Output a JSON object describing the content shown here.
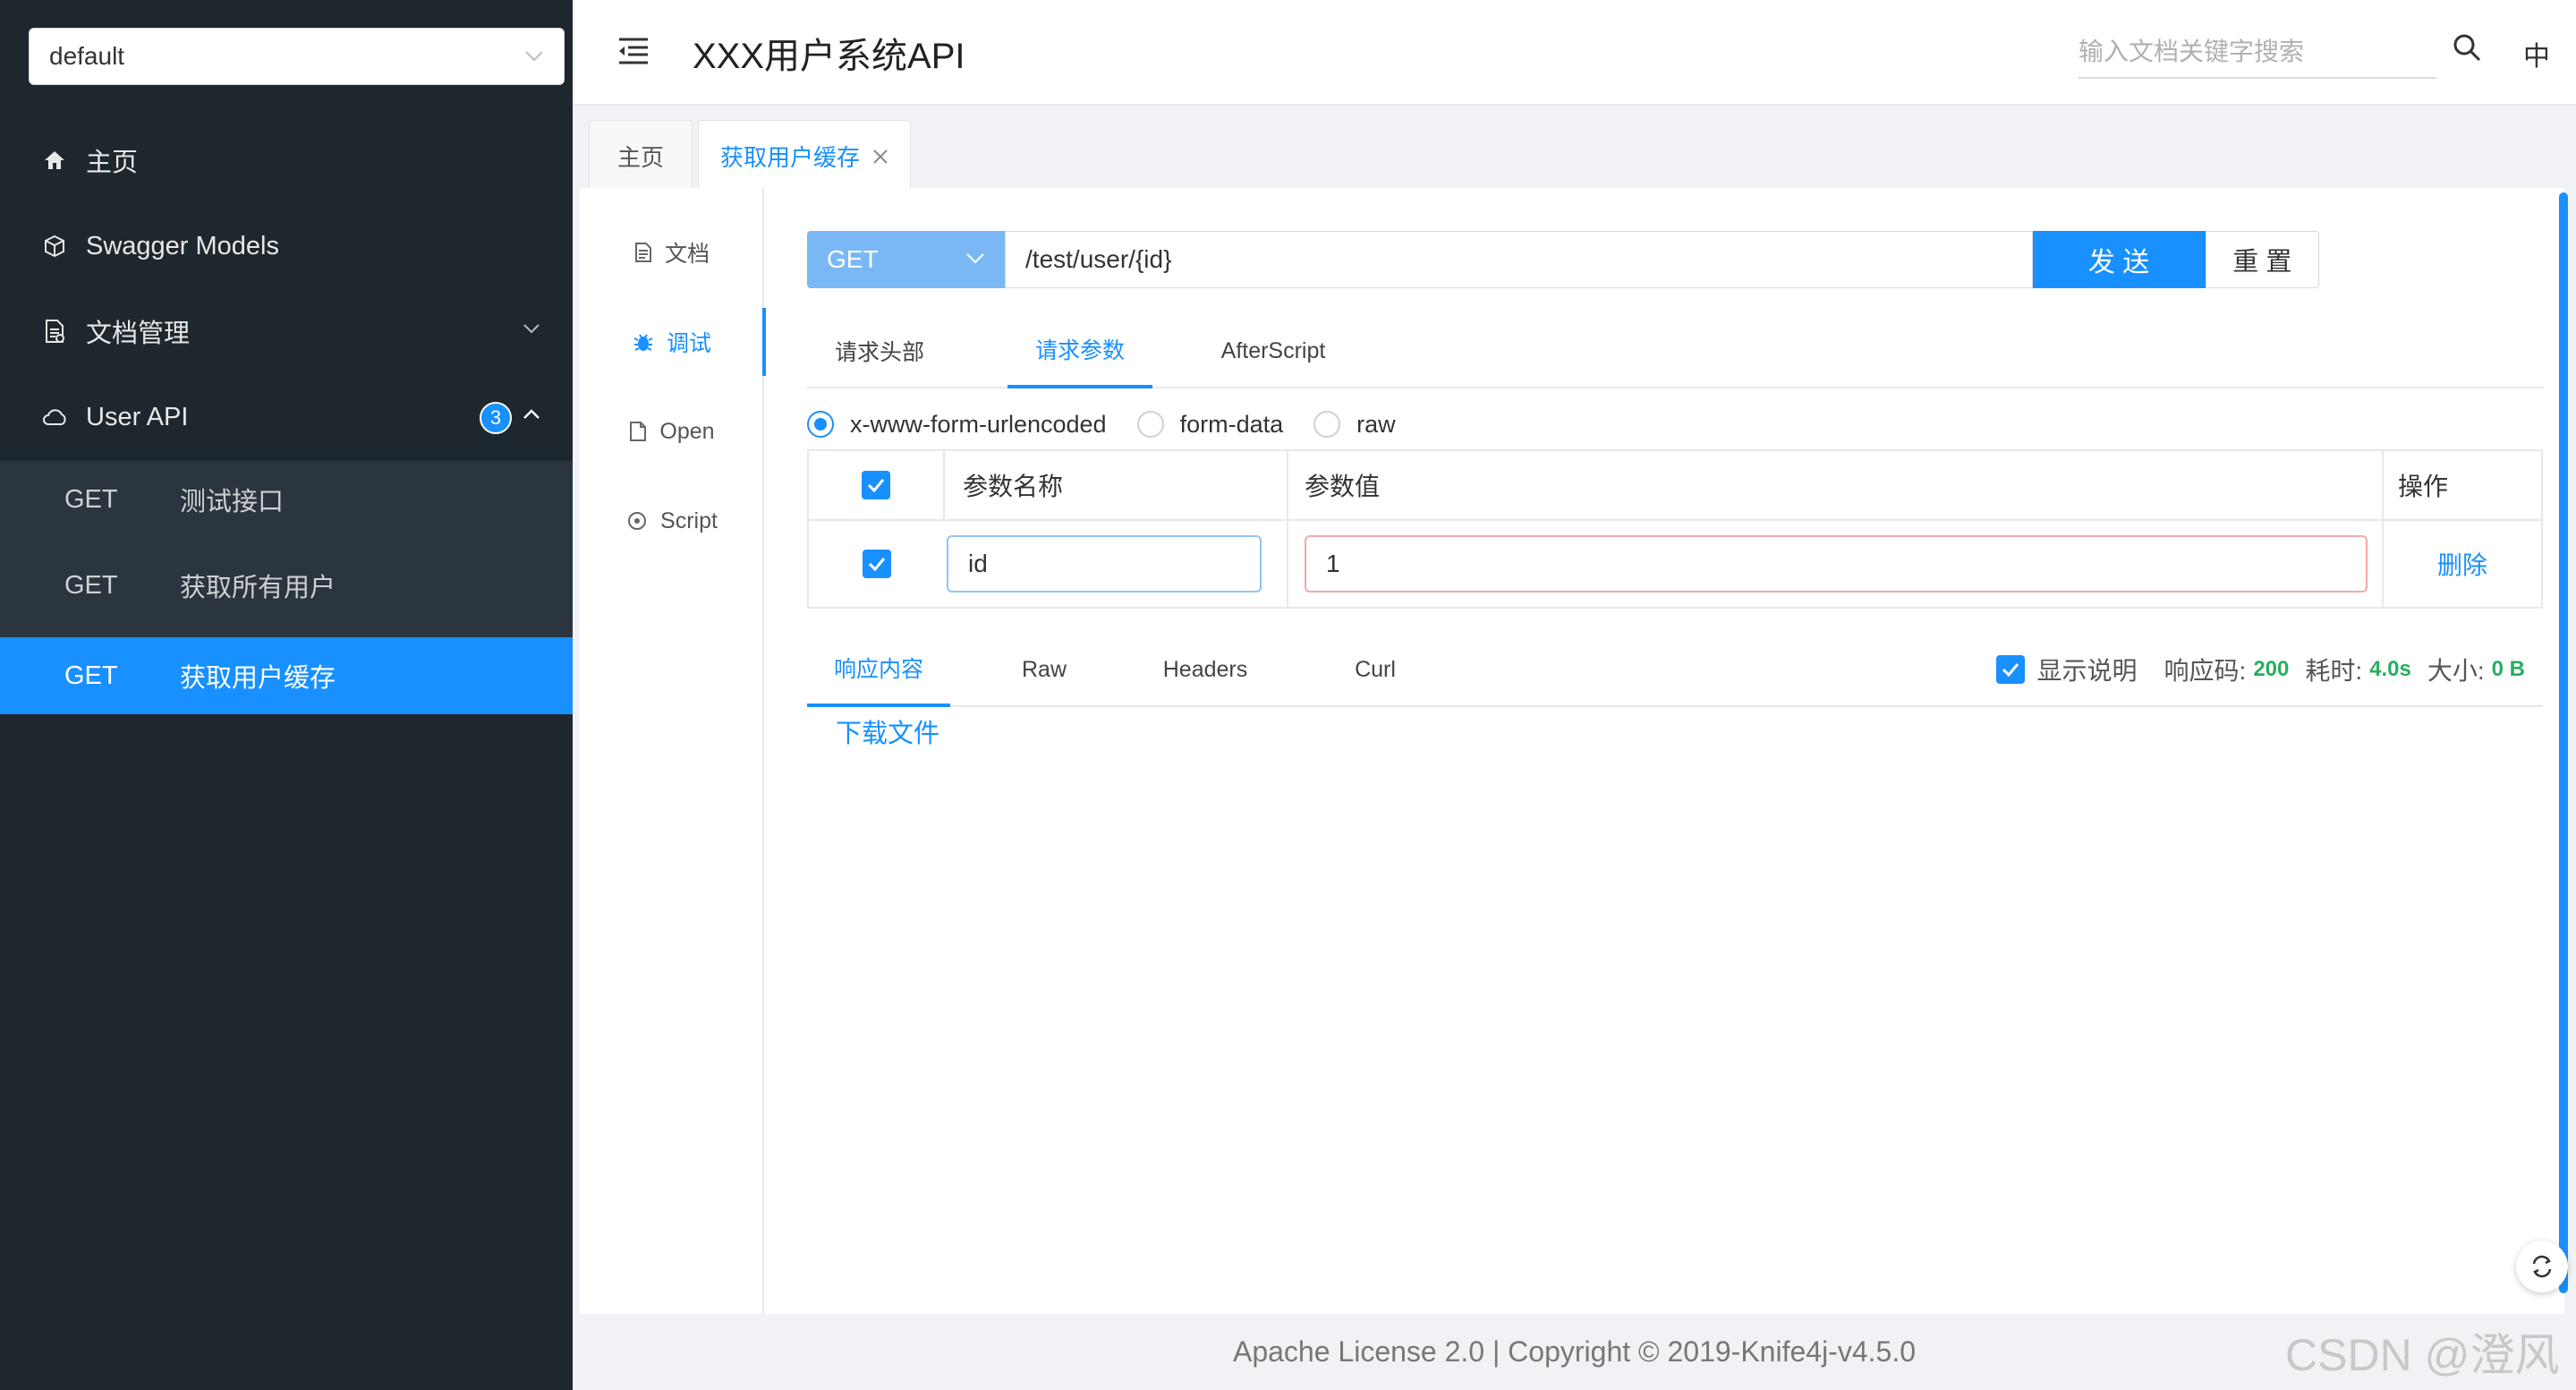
{
  "sidebar": {
    "group_select": "default",
    "items": [
      {
        "label": "主页",
        "icon": "home-icon"
      },
      {
        "label": "Swagger Models",
        "icon": "cube-icon"
      },
      {
        "label": "文档管理",
        "icon": "doc-manage-icon"
      },
      {
        "label": "User API",
        "icon": "cloud-icon",
        "badge": "3"
      }
    ],
    "sub_items": [
      {
        "method": "GET",
        "label": "测试接口"
      },
      {
        "method": "GET",
        "label": "获取所有用户"
      },
      {
        "method": "GET",
        "label": "获取用户缓存"
      }
    ]
  },
  "header": {
    "title": "XXX用户系统API",
    "search_placeholder": "输入文档关键字搜索",
    "lang": "中"
  },
  "page_tabs": [
    "主页",
    "获取用户缓存"
  ],
  "side_tabs": [
    "文档",
    "调试",
    "Open",
    "Script"
  ],
  "request": {
    "method": "GET",
    "url": "/test/user/{id}",
    "send_label": "发 送",
    "reset_label": "重 置",
    "tabs": [
      "请求头部",
      "请求参数",
      "AfterScript"
    ],
    "body_types": [
      "x-www-form-urlencoded",
      "form-data",
      "raw"
    ],
    "table": {
      "headers": [
        "参数名称",
        "参数值",
        "操作"
      ],
      "rows": [
        {
          "name": "id",
          "value": "1",
          "action": "删除"
        }
      ]
    }
  },
  "response": {
    "tabs": [
      "响应内容",
      "Raw",
      "Headers",
      "Curl"
    ],
    "show_desc": "显示说明",
    "code_label": "响应码:",
    "code": "200",
    "time_label": "耗时:",
    "time": "4.0s",
    "size_label": "大小:",
    "size": "0 B",
    "download": "下载文件"
  },
  "footer": "Apache License 2.0 | Copyright © 2019-Knife4j-v4.5.0",
  "watermark": "CSDN @澄风",
  "colors": {
    "primary": "#1890ff",
    "sidebar_bg": "#1f272e",
    "success": "#27ae60"
  }
}
